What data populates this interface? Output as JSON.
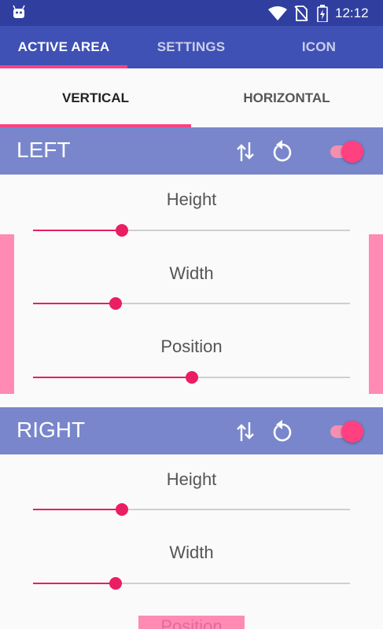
{
  "status_bar": {
    "time": "12:12",
    "icons": [
      "android-icon",
      "wifi-icon",
      "no-sim-icon",
      "battery-charging-icon"
    ]
  },
  "main_tabs": {
    "items": [
      {
        "label": "ACTIVE AREA",
        "active": true
      },
      {
        "label": "SETTINGS",
        "active": false
      },
      {
        "label": "ICON",
        "active": false
      }
    ]
  },
  "sub_tabs": {
    "items": [
      {
        "label": "VERTICAL",
        "active": true
      },
      {
        "label": "HORIZONTAL",
        "active": false
      }
    ]
  },
  "sections": {
    "left": {
      "title": "LEFT",
      "enabled": true,
      "icons": [
        "swap-vertical-icon",
        "reset-icon"
      ],
      "height_label": "Height",
      "height_value": 0.28,
      "width_label": "Width",
      "width_value": 0.26,
      "position_label": "Position",
      "position_value": 0.5
    },
    "right": {
      "title": "RIGHT",
      "enabled": true,
      "icons": [
        "swap-vertical-icon",
        "reset-icon"
      ],
      "height_label": "Height",
      "height_value": 0.28,
      "width_label": "Width",
      "width_value": 0.26,
      "position_label": "Position"
    }
  },
  "colors": {
    "primary_dark": "#303F9F",
    "primary": "#3F51B5",
    "section_header": "#7986CB",
    "accent": "#FF4081",
    "slider": "#E91E63",
    "edge_preview": "#FF8AB3"
  }
}
